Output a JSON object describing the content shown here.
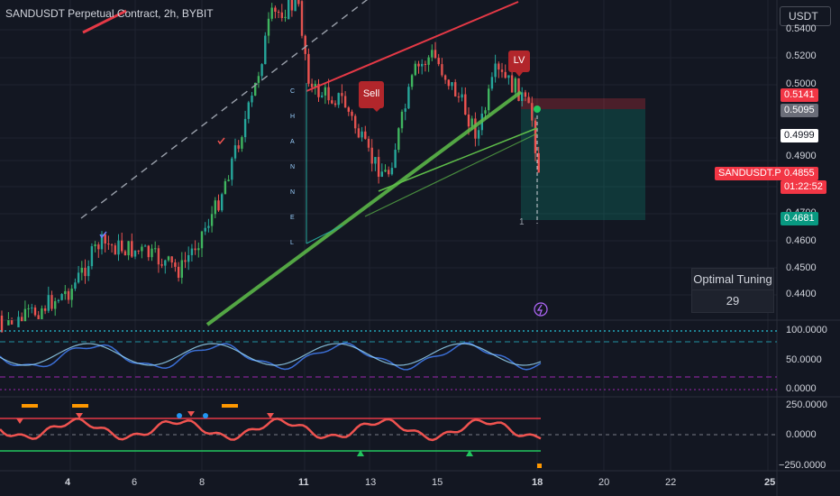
{
  "header": {
    "title": "SANDUSDT Perpetual Contract, 2h, BYBIT"
  },
  "currency_button": {
    "label": "USDT"
  },
  "price_axis": {
    "labels": [
      "0.5400",
      "0.5200",
      "0.5000",
      "0.4900",
      "0.4800",
      "0.4700",
      "0.4600",
      "0.4500",
      "0.4400"
    ],
    "tags": {
      "price_5141": "0.5141",
      "price_5095": "0.5095",
      "price_4999": "0.4999",
      "symbol": "SANDUSDT.P",
      "last_price": "0.4855",
      "countdown": "01:22:52",
      "price_4681": "0.4681"
    }
  },
  "indicator_axis": {
    "rsi": [
      "100.0000",
      "50.0000",
      "0.0000"
    ],
    "osc": [
      "250.0000",
      "0.0000",
      "−250.0000"
    ]
  },
  "time_axis": {
    "labels": [
      "4",
      "6",
      "8",
      "11",
      "13",
      "15",
      "18",
      "20",
      "22",
      "25"
    ],
    "bold": [
      "4",
      "11",
      "18",
      "25"
    ]
  },
  "signals": {
    "sell": "Sell",
    "lv": "LV"
  },
  "channel_letters": [
    "C",
    "H",
    "A",
    "N",
    "N",
    "E",
    "L"
  ],
  "trade_marker": "1",
  "optimal_tuning": {
    "title": "Optimal Tuning",
    "value": "29"
  },
  "colors": {
    "bull": "#26a69a",
    "bear": "#ef5350",
    "sell": "#b2262b",
    "green_line": "#5fbf4a",
    "red_line": "#e53946"
  }
}
